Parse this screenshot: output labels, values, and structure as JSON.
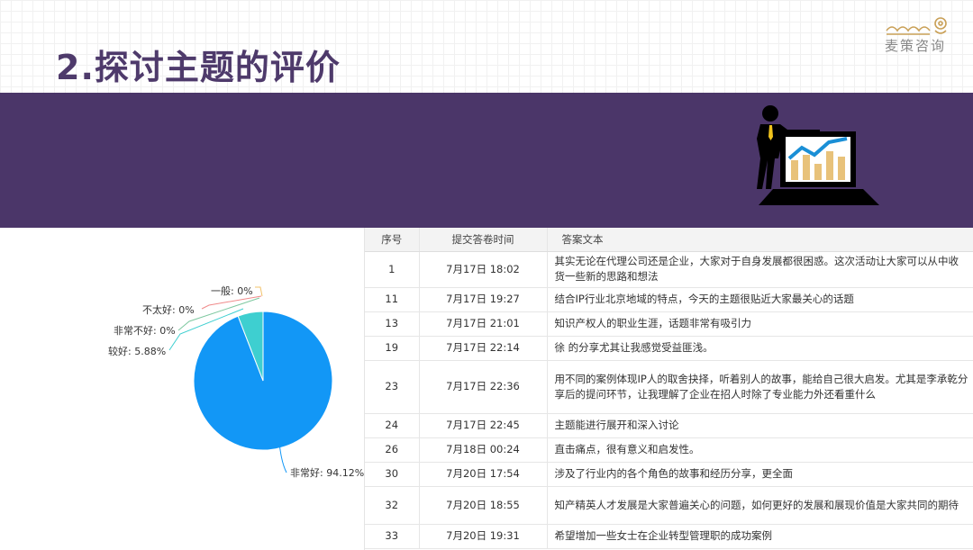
{
  "slide": {
    "title": "2.探讨主题的评价",
    "logo_text": "麦策咨询"
  },
  "colors": {
    "band": "#4b3669",
    "title": "#4e3a6b",
    "pie_main": "#1297f6",
    "pie_second": "#3ecfd0"
  },
  "pie_labels": {
    "general": "一般: 0%",
    "not_good": "不太好: 0%",
    "very_bad": "非常不好: 0%",
    "good": "较好: 5.88%",
    "very_good": "非常好: 94.12%"
  },
  "chart_data": {
    "type": "pie",
    "categories": [
      "非常好",
      "较好",
      "一般",
      "不太好",
      "非常不好"
    ],
    "values": [
      94.12,
      5.88,
      0,
      0,
      0
    ]
  },
  "table": {
    "headers": [
      "序号",
      "提交答卷时间",
      "答案文本"
    ],
    "rows": [
      {
        "no": "1",
        "time": "7月17日 18:02",
        "text": "其实无论在代理公司还是企业，大家对于自身发展都很困惑。这次活动让大家可以从中收货一些新的思路和想法"
      },
      {
        "no": "11",
        "time": "7月17日 19:27",
        "text": "结合IP行业北京地域的特点，今天的主题很贴近大家最关心的话题"
      },
      {
        "no": "13",
        "time": "7月17日 21:01",
        "text": "知识产权人的职业生涯，话题非常有吸引力"
      },
      {
        "no": "19",
        "time": "7月17日 22:14",
        "text": "徐  的分享尤其让我感觉受益匪浅。"
      },
      {
        "no": "23",
        "time": "7月17日 22:36",
        "text": "用不同的案例体现IP人的取舍抉择，听着别人的故事，能给自己很大启发。尤其是李承乾分享后的提问环节，让我理解了企业在招人时除了专业能力外还看重什么"
      },
      {
        "no": "24",
        "time": "7月17日 22:45",
        "text": "主题能进行展开和深入讨论"
      },
      {
        "no": "26",
        "time": "7月18日 00:24",
        "text": "直击痛点，很有意义和启发性。"
      },
      {
        "no": "30",
        "time": "7月20日 17:54",
        "text": "涉及了行业内的各个角色的故事和经历分享，更全面"
      },
      {
        "no": "32",
        "time": "7月20日 18:55",
        "text": "知产精英人才发展是大家普遍关心的问题，如何更好的发展和展现价值是大家共同的期待"
      },
      {
        "no": "33",
        "time": "7月20日 19:31",
        "text": "希望增加一些女士在企业转型管理职的成功案例"
      }
    ]
  }
}
